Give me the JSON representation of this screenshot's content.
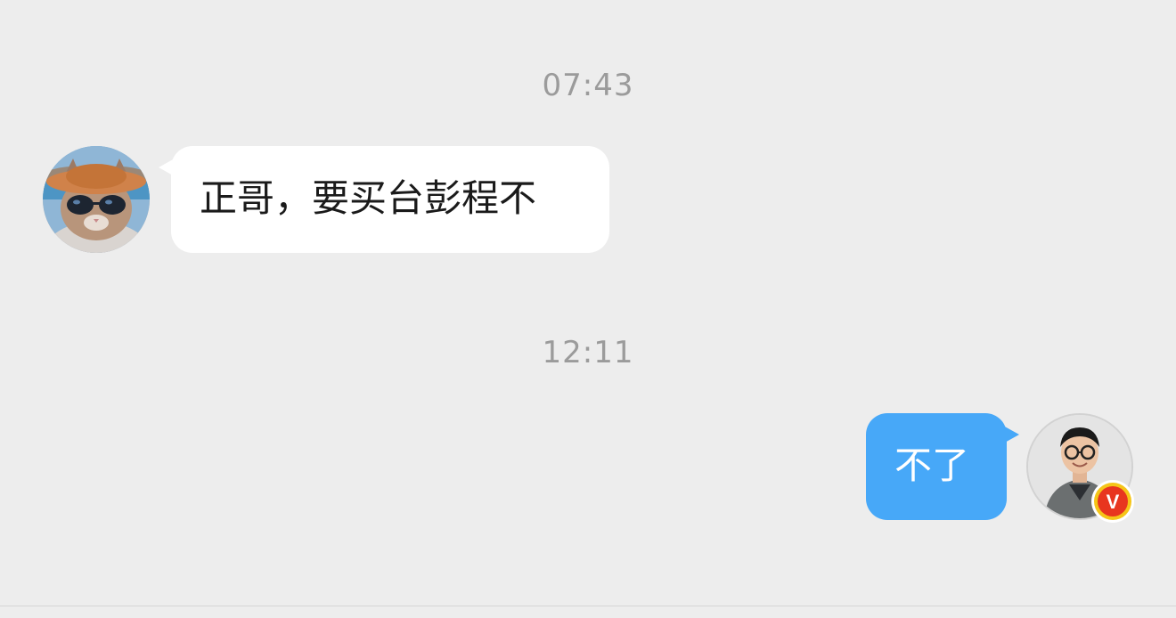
{
  "messages": [
    {
      "timestamp": "07:43",
      "sender": "other",
      "text": "正哥，要买台彭程不",
      "avatar_icon": "cat-with-sunglasses-avatar"
    },
    {
      "timestamp": "12:11",
      "sender": "self",
      "text": "不了",
      "avatar_icon": "man-with-glasses-avatar",
      "badge_text": "V"
    }
  ],
  "colors": {
    "background": "#ededed",
    "incoming_bubble": "#ffffff",
    "outgoing_bubble": "#47a8f8",
    "timestamp_text": "#9b9b9b",
    "badge": "#f5c518",
    "badge_inner": "#e8351f"
  }
}
